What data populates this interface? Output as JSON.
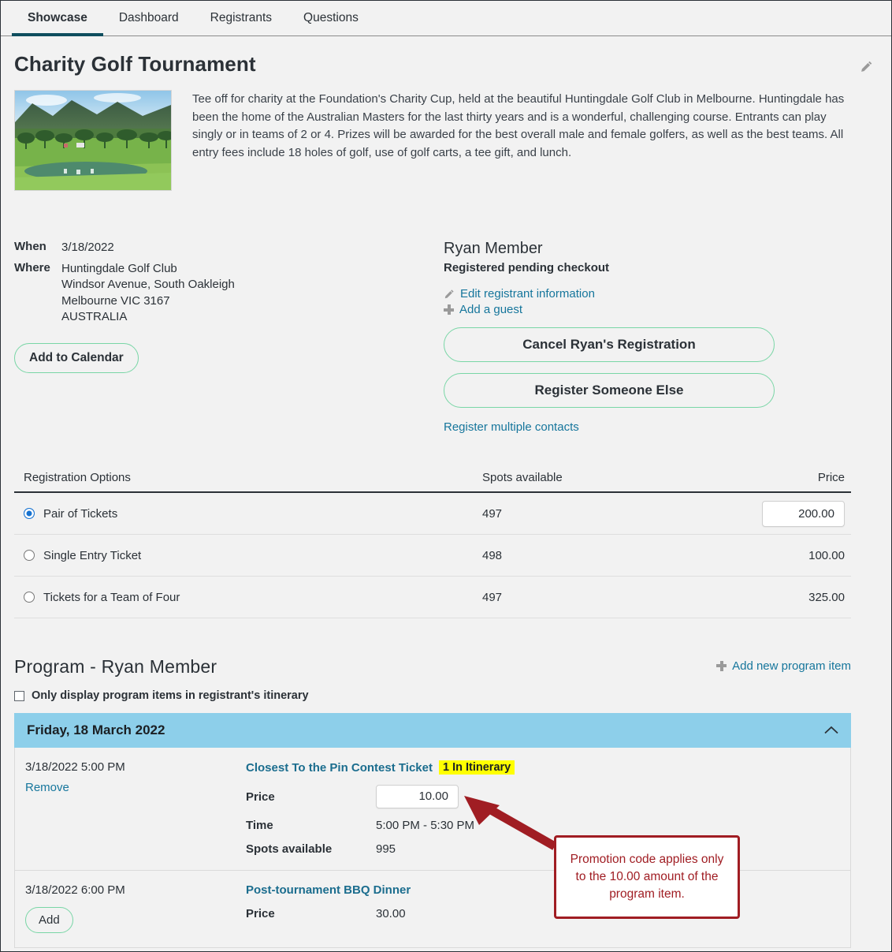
{
  "tabs": [
    {
      "label": "Showcase",
      "active": true
    },
    {
      "label": "Dashboard",
      "active": false
    },
    {
      "label": "Registrants",
      "active": false
    },
    {
      "label": "Questions",
      "active": false
    }
  ],
  "event": {
    "title": "Charity Golf Tournament",
    "description": "Tee off for charity at the Foundation's Charity Cup, held at the beautiful Huntingdale Golf Club in Melbourne. Huntingdale has been the home of the Australian Masters for the last thirty years and is a wonderful, challenging course. Entrants can play singly or in teams of 2 or 4. Prizes will be awarded for the best overall male and female golfers, as well as the best teams. All entry fees include 18 holes of golf, use of golf carts, a tee gift, and lunch.",
    "when_label": "When",
    "when_value": "3/18/2022",
    "where_label": "Where",
    "where_line1": "Huntingdale Golf Club",
    "where_line2": "Windsor Avenue, South Oakleigh",
    "where_line3": "Melbourne VIC 3167",
    "where_line4": "AUSTRALIA",
    "add_to_calendar": "Add to Calendar",
    "edit_icon": "pencil-icon"
  },
  "registrant": {
    "name": "Ryan Member",
    "status": "Registered pending checkout",
    "edit_link": "Edit registrant information",
    "add_guest_link": "Add a guest",
    "cancel_button": "Cancel Ryan's Registration",
    "register_someone_button": "Register Someone Else",
    "register_multiple_link": "Register multiple contacts"
  },
  "registration_options": {
    "headers": [
      "Registration Options",
      "Spots available",
      "Price"
    ],
    "rows": [
      {
        "label": "Pair of Tickets",
        "spots": "497",
        "price": "200.00",
        "selected": true,
        "price_is_input": true
      },
      {
        "label": "Single Entry Ticket",
        "spots": "498",
        "price": "100.00",
        "selected": false,
        "price_is_input": false
      },
      {
        "label": "Tickets for a Team of Four",
        "spots": "497",
        "price": "325.00",
        "selected": false,
        "price_is_input": false
      }
    ]
  },
  "program": {
    "title": "Program - Ryan Member",
    "add_item_link": "Add new program item",
    "filter_checkbox_label": "Only display program items in registrant's itinerary",
    "filter_checked": false,
    "day_header": "Friday, 18 March 2022",
    "collapse_icon": "chevron-up-icon",
    "items": [
      {
        "datetime": "3/18/2022 5:00 PM",
        "action": "Remove",
        "action_type": "link",
        "name": "Closest To the Pin Contest Ticket",
        "badge": "1 In Itinerary",
        "price_label": "Price",
        "price_value": "10.00",
        "price_is_input": true,
        "time_label": "Time",
        "time_value": "5:00 PM - 5:30 PM",
        "spots_label": "Spots available",
        "spots_value": "995"
      },
      {
        "datetime": "3/18/2022 6:00 PM",
        "action": "Add",
        "action_type": "button",
        "name": "Post-tournament BBQ Dinner",
        "badge": "",
        "price_label": "Price",
        "price_value": "30.00",
        "price_is_input": false,
        "time_label": "",
        "time_value": "",
        "spots_label": "",
        "spots_value": ""
      }
    ]
  },
  "annotation": {
    "text": "Promotion code applies only to the 10.00 amount of the program item.",
    "color": "#a01d23"
  },
  "colors": {
    "page_bg": "#f2f2f2",
    "active_tab_underline": "#0f4e5e",
    "link": "#16769c",
    "pill_border": "#79d6a6",
    "day_bar": "#8dcfea",
    "badge_bg": "#ffff00",
    "annotation": "#a01d23"
  }
}
